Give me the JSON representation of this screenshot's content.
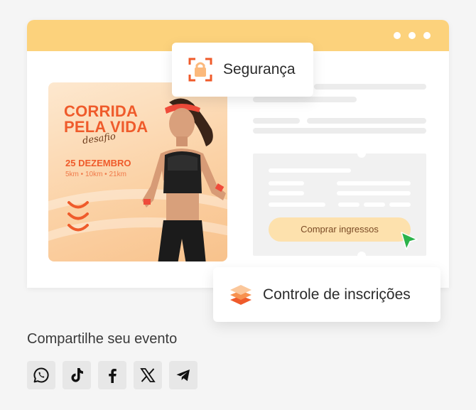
{
  "poster": {
    "title_line1": "CORRIDA",
    "title_line2": "PELA VIDA",
    "subtitle": "desafio",
    "date": "25 DEZEMBRO",
    "distances": "5km • 10km • 21km"
  },
  "checkout": {
    "buy_label": "Comprar ingressos"
  },
  "chips": {
    "security": "Segurança",
    "registration_control": "Controle de inscrições"
  },
  "share": {
    "title": "Compartilhe seu evento",
    "icons": [
      "whatsapp-icon",
      "tiktok-icon",
      "facebook-icon",
      "x-icon",
      "telegram-icon"
    ]
  },
  "colors": {
    "titlebar": "#fcd27c",
    "accent_orange": "#ef5b2b",
    "button": "#fde1ad",
    "cursor": "#2bb34a"
  }
}
